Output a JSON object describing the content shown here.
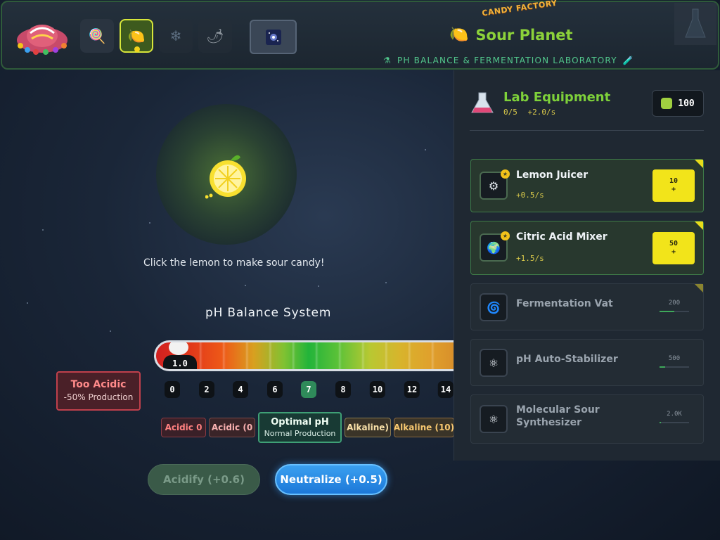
{
  "header": {
    "factory_logo": "CANDY FACTORY",
    "planet_name": "Sour Planet",
    "planet_icon": "lemon-icon",
    "subtitle": "PH BALANCE & FERMENTATION LABORATORY",
    "planets": [
      {
        "icon": "lollipop-icon",
        "glyph": "🍭",
        "state": "available"
      },
      {
        "icon": "lemon-icon",
        "glyph": "🍋",
        "state": "active"
      },
      {
        "icon": "snowflake-icon",
        "glyph": "❄",
        "state": "locked"
      },
      {
        "icon": "chili-icon",
        "glyph": "🌶",
        "state": "locked"
      }
    ],
    "galaxy_icon": "galaxy-icon"
  },
  "main": {
    "click_hint": "Click the lemon to make sour candy!",
    "ph_title": "pH Balance System",
    "ph_value": "1.0",
    "ph_level": 1.0,
    "ph_ticks": [
      "0",
      "2",
      "4",
      "6",
      "7",
      "8",
      "10",
      "12",
      "14"
    ],
    "ph_active_tick": "7",
    "status": {
      "title": "Too Acidic",
      "effect": "-50% Production"
    },
    "zones": {
      "acidic1": "Acidic 0",
      "acidic2": "Acidic (0",
      "optimal_title": "Optimal pH",
      "optimal_sub": "Normal Production",
      "alkaline1": "Alkaline)",
      "alkaline2": "Alkaline (10)"
    },
    "buttons": {
      "acidify": "Acidify (+0.6)",
      "neutralize": "Neutralize (+0.5)"
    }
  },
  "panel": {
    "title": "Lab Equipment",
    "owned": "0/5",
    "rate": "+2.0/s",
    "coins": "100",
    "upgrades": [
      {
        "name": "Lemon Juicer",
        "rate": "+0.5/s",
        "cost": "10",
        "buy": "+",
        "state": "buyable",
        "icon": "gear-icon",
        "glyph": "⚙"
      },
      {
        "name": "Citric Acid Mixer",
        "rate": "+1.5/s",
        "cost": "50",
        "buy": "+",
        "state": "buyable",
        "icon": "globe-icon",
        "glyph": "🌍"
      },
      {
        "name": "Fermentation Vat",
        "cost": "200",
        "progress": 0.5,
        "state": "locked",
        "icon": "swirl-icon",
        "glyph": "🌀"
      },
      {
        "name": "pH Auto-Stabilizer",
        "cost": "500",
        "progress": 0.2,
        "state": "locked",
        "icon": "atom-icon",
        "glyph": "⚛"
      },
      {
        "name": "Molecular Sour",
        "name2": "Synthesizer",
        "cost": "2.0K",
        "progress": 0.05,
        "state": "locked",
        "icon": "atom-icon",
        "glyph": "⚛"
      }
    ]
  }
}
